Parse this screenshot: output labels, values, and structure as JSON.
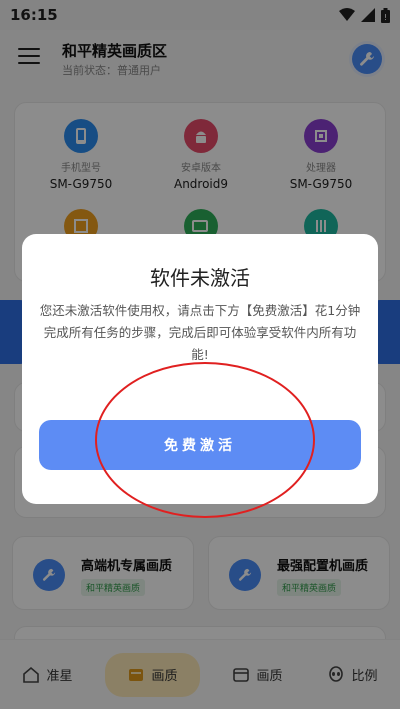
{
  "status_bar": {
    "time": "16:15"
  },
  "header": {
    "title": "和平精英画质区",
    "subtitle": "当前状态：普通用户"
  },
  "device_info": {
    "items": [
      {
        "label": "手机型号",
        "value": "SM-G9750",
        "color": "#2b8df0",
        "icon": "phone-icon"
      },
      {
        "label": "安卓版本",
        "value": "Android9",
        "color": "#e84b6a",
        "icon": "android-icon"
      },
      {
        "label": "处理器",
        "value": "SM-G9750",
        "color": "#8a3fd1",
        "icon": "cpu-icon"
      }
    ],
    "row2_icons": [
      {
        "color": "#f0a020",
        "icon": "resolution-icon"
      },
      {
        "color": "#2fb05a",
        "icon": "battery-icon"
      },
      {
        "color": "#1eb8a0",
        "icon": "sliders-icon"
      }
    ]
  },
  "features": [
    {
      "title": "高端机专属画质",
      "tag": "和平精英画质"
    },
    {
      "title": "最强配置机画质",
      "tag": "和平精英画质"
    }
  ],
  "bottom_nav": [
    {
      "label": "准星",
      "icon": "home-icon"
    },
    {
      "label": "画质",
      "icon": "image-icon",
      "active": true
    },
    {
      "label": "画质",
      "icon": "box-icon"
    },
    {
      "label": "比例",
      "icon": "alien-icon"
    }
  ],
  "dialog": {
    "title": "软件未激活",
    "message": "您还未激活软件使用权，请点击下方【免费激活】花1分钟完成所有任务的步骤，完成后即可体验享受软件内所有功能!",
    "button_label": "免费激活"
  },
  "colors": {
    "accent": "#5d8cf4",
    "annotation": "#e02020"
  }
}
